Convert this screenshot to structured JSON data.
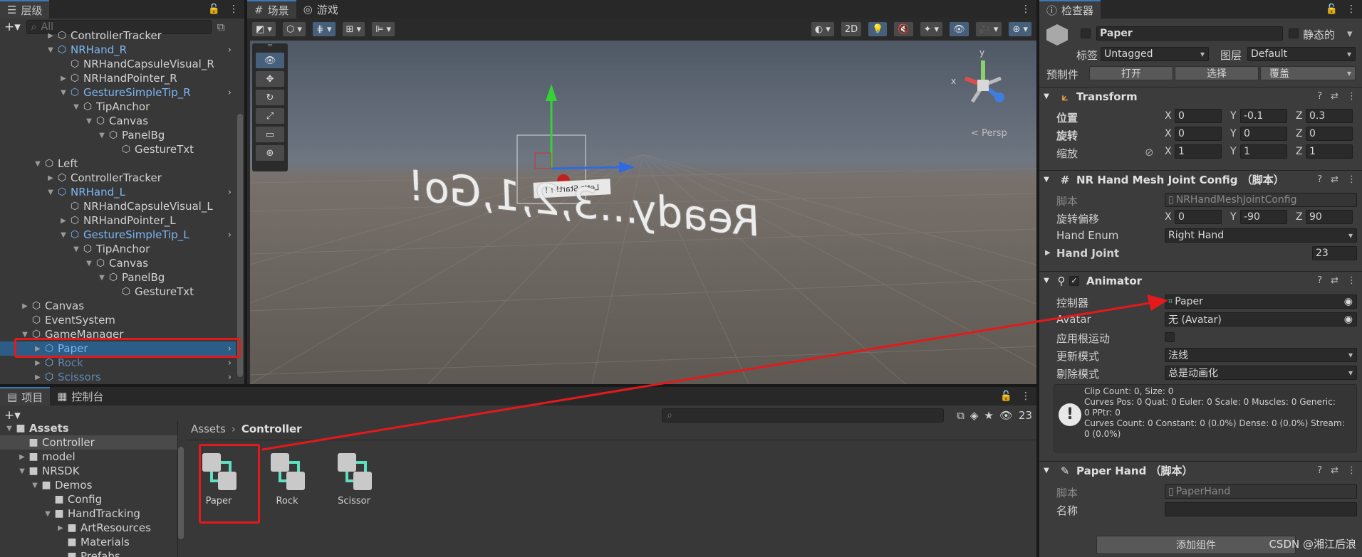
{
  "hierarchy": {
    "tab_label": "层级",
    "search_placeholder": "All",
    "rows": [
      {
        "label": "ControllerTracker",
        "indent": 4,
        "arrow": "▶",
        "cube": "normal",
        "style": "normal"
      },
      {
        "label": "NRHand_R",
        "indent": 4,
        "arrow": "▼",
        "cube": "blue",
        "style": "blue",
        "more": true
      },
      {
        "label": "NRHandCapsuleVisual_R",
        "indent": 5,
        "arrow": "",
        "cube": "normal",
        "style": "normal"
      },
      {
        "label": "NRHandPointer_R",
        "indent": 5,
        "arrow": "▶",
        "cube": "normal",
        "style": "normal"
      },
      {
        "label": "GestureSimpleTip_R",
        "indent": 5,
        "arrow": "▼",
        "cube": "blue",
        "style": "blue",
        "more": true
      },
      {
        "label": "TipAnchor",
        "indent": 6,
        "arrow": "▼",
        "cube": "normal",
        "style": "normal"
      },
      {
        "label": "Canvas",
        "indent": 7,
        "arrow": "▼",
        "cube": "normal",
        "style": "normal"
      },
      {
        "label": "PanelBg",
        "indent": 8,
        "arrow": "▼",
        "cube": "normal",
        "style": "normal"
      },
      {
        "label": "GestureTxt",
        "indent": 9,
        "arrow": "",
        "cube": "normal",
        "style": "normal"
      },
      {
        "label": "Left",
        "indent": 3,
        "arrow": "▼",
        "cube": "normal",
        "style": "normal"
      },
      {
        "label": "ControllerTracker",
        "indent": 4,
        "arrow": "▶",
        "cube": "normal",
        "style": "normal"
      },
      {
        "label": "NRHand_L",
        "indent": 4,
        "arrow": "▼",
        "cube": "blue",
        "style": "blue",
        "more": true
      },
      {
        "label": "NRHandCapsuleVisual_L",
        "indent": 5,
        "arrow": "",
        "cube": "normal",
        "style": "normal"
      },
      {
        "label": "NRHandPointer_L",
        "indent": 5,
        "arrow": "▶",
        "cube": "normal",
        "style": "normal"
      },
      {
        "label": "GestureSimpleTip_L",
        "indent": 5,
        "arrow": "▼",
        "cube": "blue",
        "style": "blue",
        "more": true
      },
      {
        "label": "TipAnchor",
        "indent": 6,
        "arrow": "▼",
        "cube": "normal",
        "style": "normal"
      },
      {
        "label": "Canvas",
        "indent": 7,
        "arrow": "▼",
        "cube": "normal",
        "style": "normal"
      },
      {
        "label": "PanelBg",
        "indent": 8,
        "arrow": "▼",
        "cube": "normal",
        "style": "normal"
      },
      {
        "label": "GestureTxt",
        "indent": 9,
        "arrow": "",
        "cube": "normal",
        "style": "normal"
      },
      {
        "label": "Canvas",
        "indent": 2,
        "arrow": "▶",
        "cube": "normal",
        "style": "normal"
      },
      {
        "label": "EventSystem",
        "indent": 2,
        "arrow": "",
        "cube": "normal",
        "style": "normal"
      },
      {
        "label": "GameManager",
        "indent": 2,
        "arrow": "▼",
        "cube": "normal",
        "style": "normal"
      },
      {
        "label": "Paper",
        "indent": 3,
        "arrow": "▶",
        "cube": "blue",
        "style": "sel",
        "more": true
      },
      {
        "label": "Rock",
        "indent": 3,
        "arrow": "▶",
        "cube": "blue",
        "style": "dim",
        "more": true
      },
      {
        "label": "Scissors",
        "indent": 3,
        "arrow": "▶",
        "cube": "blue",
        "style": "dim",
        "more": true
      }
    ]
  },
  "scene": {
    "tabs": [
      "场景",
      "游戏"
    ],
    "btn_2d": "2D",
    "mirrored_text": "Ready...3,2,1,Go!",
    "sign_text": "Let's Start! ! !",
    "gizmo": {
      "x": "x",
      "y": "y",
      "persp": "< Persp"
    }
  },
  "project": {
    "tabs": [
      "项目",
      "控制台"
    ],
    "count": "23",
    "breadcrumb": [
      "Assets",
      "Controller"
    ],
    "tree": [
      {
        "label": "Assets",
        "indent": 0,
        "arrow": "▼",
        "bold": true
      },
      {
        "label": "Controller",
        "indent": 1,
        "arrow": "",
        "sel": true
      },
      {
        "label": "model",
        "indent": 1,
        "arrow": "▶"
      },
      {
        "label": "NRSDK",
        "indent": 1,
        "arrow": "▼"
      },
      {
        "label": "Demos",
        "indent": 2,
        "arrow": "▼"
      },
      {
        "label": "Config",
        "indent": 3,
        "arrow": ""
      },
      {
        "label": "HandTracking",
        "indent": 3,
        "arrow": "▼"
      },
      {
        "label": "ArtResources",
        "indent": 4,
        "arrow": "▶"
      },
      {
        "label": "Materials",
        "indent": 4,
        "arrow": ""
      },
      {
        "label": "Prefabs",
        "indent": 4,
        "arrow": ""
      }
    ],
    "assets": [
      "Paper",
      "Rock",
      "Scissor"
    ]
  },
  "inspector": {
    "tab_label": "检查器",
    "object_name": "Paper",
    "static_label": "静态的",
    "tag_label": "标签",
    "tag_value": "Untagged",
    "layer_label": "图层",
    "layer_value": "Default",
    "prefab_label": "预制件",
    "prefab_open": "打开",
    "prefab_select": "选择",
    "prefab_override": "覆盖",
    "transform": {
      "title": "Transform",
      "position_label": "位置",
      "rotation_label": "旋转",
      "scale_label": "缩放",
      "position": [
        "0",
        "-0.1",
        "0.3"
      ],
      "rotation": [
        "0",
        "0",
        "0"
      ],
      "scale": [
        "1",
        "1",
        "1"
      ]
    },
    "hand_mesh": {
      "title": "NR Hand Mesh Joint Config （脚本）",
      "script_label": "脚本",
      "script_value": "NRHandMeshJointConfig",
      "rot_offset_label": "旋转偏移",
      "rot_offset": [
        "0",
        "-90",
        "90"
      ],
      "hand_enum_label": "Hand Enum",
      "hand_enum_value": "Right Hand",
      "hand_joint_label": "Hand Joint",
      "hand_joint_value": "23"
    },
    "animator": {
      "title": "Animator",
      "controller_label": "控制器",
      "controller_value": "Paper",
      "avatar_label": "Avatar",
      "avatar_value": "无 (Avatar)",
      "root_motion_label": "应用根运动",
      "update_label": "更新模式",
      "update_value": "法线",
      "culling_label": "剔除模式",
      "culling_value": "总是动画化",
      "info": [
        "Clip Count: 0, Size: 0",
        "Curves Pos: 0 Quat: 0 Euler: 0 Scale: 0 Muscles: 0 Generic:",
        "0 PPtr: 0",
        "Curves Count: 0 Constant: 0 (0.0%) Dense: 0 (0.0%) Stream:",
        "0 (0.0%)"
      ]
    },
    "paper_hand": {
      "title": "Paper Hand （脚本）",
      "script_label": "脚本",
      "script_value": "PaperHand",
      "name_label": "名称"
    },
    "add_component": "添加组件"
  },
  "watermark": "CSDN @湘江后浪",
  "colors": {
    "accent": "#3a79bb",
    "highlight": "#e5191b",
    "selection": "#2c5d87"
  }
}
